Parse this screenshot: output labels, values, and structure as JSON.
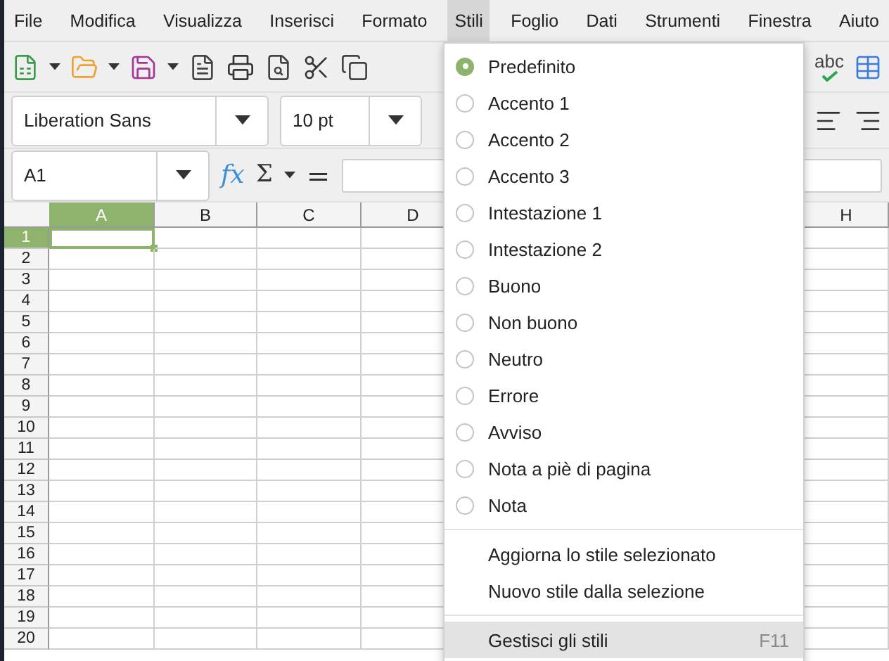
{
  "menubar": [
    {
      "label": "File",
      "selected": false
    },
    {
      "label": "Modifica",
      "selected": false
    },
    {
      "label": "Visualizza",
      "selected": false
    },
    {
      "label": "Inserisci",
      "selected": false
    },
    {
      "label": "Formato",
      "selected": false
    },
    {
      "label": "Stili",
      "selected": true
    },
    {
      "label": "Foglio",
      "selected": false
    },
    {
      "label": "Dati",
      "selected": false
    },
    {
      "label": "Strumenti",
      "selected": false
    },
    {
      "label": "Finestra",
      "selected": false
    },
    {
      "label": "Aiuto",
      "selected": false
    }
  ],
  "toolbar": {
    "spellcheck_label": "abc"
  },
  "font_bar": {
    "font_name": "Liberation Sans",
    "font_size": "10 pt"
  },
  "formula_bar": {
    "cell_ref": "A1",
    "function_label": "fx",
    "sum_label": "Σ",
    "equals_label": "="
  },
  "sheet": {
    "columns": [
      {
        "label": "A",
        "selected": true
      },
      {
        "label": "B",
        "selected": false
      },
      {
        "label": "C",
        "selected": false
      },
      {
        "label": "D",
        "selected": false
      },
      {
        "label": "H",
        "selected": false
      }
    ],
    "rows": [
      {
        "label": "1",
        "selected": true
      },
      {
        "label": "2",
        "selected": false
      },
      {
        "label": "3",
        "selected": false
      },
      {
        "label": "4",
        "selected": false
      },
      {
        "label": "5",
        "selected": false
      },
      {
        "label": "6",
        "selected": false
      },
      {
        "label": "7",
        "selected": false
      },
      {
        "label": "8",
        "selected": false
      },
      {
        "label": "9",
        "selected": false
      },
      {
        "label": "10",
        "selected": false
      },
      {
        "label": "11",
        "selected": false
      },
      {
        "label": "12",
        "selected": false
      },
      {
        "label": "13",
        "selected": false
      },
      {
        "label": "14",
        "selected": false
      },
      {
        "label": "15",
        "selected": false
      },
      {
        "label": "16",
        "selected": false
      },
      {
        "label": "17",
        "selected": false
      },
      {
        "label": "18",
        "selected": false
      },
      {
        "label": "19",
        "selected": false
      },
      {
        "label": "20",
        "selected": false
      }
    ]
  },
  "styles_menu": {
    "groups": [
      [
        {
          "kind": "radio",
          "label": "Predefinito",
          "selected": true
        },
        {
          "kind": "radio",
          "label": "Accento 1",
          "selected": false
        },
        {
          "kind": "radio",
          "label": "Accento 2",
          "selected": false
        },
        {
          "kind": "radio",
          "label": "Accento 3",
          "selected": false
        },
        {
          "kind": "radio",
          "label": "Intestazione 1",
          "selected": false
        },
        {
          "kind": "radio",
          "label": "Intestazione 2",
          "selected": false
        },
        {
          "kind": "radio",
          "label": "Buono",
          "selected": false
        },
        {
          "kind": "radio",
          "label": "Non buono",
          "selected": false
        },
        {
          "kind": "radio",
          "label": "Neutro",
          "selected": false
        },
        {
          "kind": "radio",
          "label": "Errore",
          "selected": false
        },
        {
          "kind": "radio",
          "label": "Avviso",
          "selected": false
        },
        {
          "kind": "radio",
          "label": "Nota a piè di pagina",
          "selected": false
        },
        {
          "kind": "radio",
          "label": "Nota",
          "selected": false
        }
      ],
      [
        {
          "kind": "action",
          "label": "Aggiorna lo stile selezionato",
          "highlighted": false
        },
        {
          "kind": "action",
          "label": "Nuovo stile dalla selezione",
          "highlighted": false
        }
      ],
      [
        {
          "kind": "action",
          "label": "Gestisci gli stili",
          "shortcut": "F11",
          "highlighted": true
        }
      ]
    ]
  }
}
